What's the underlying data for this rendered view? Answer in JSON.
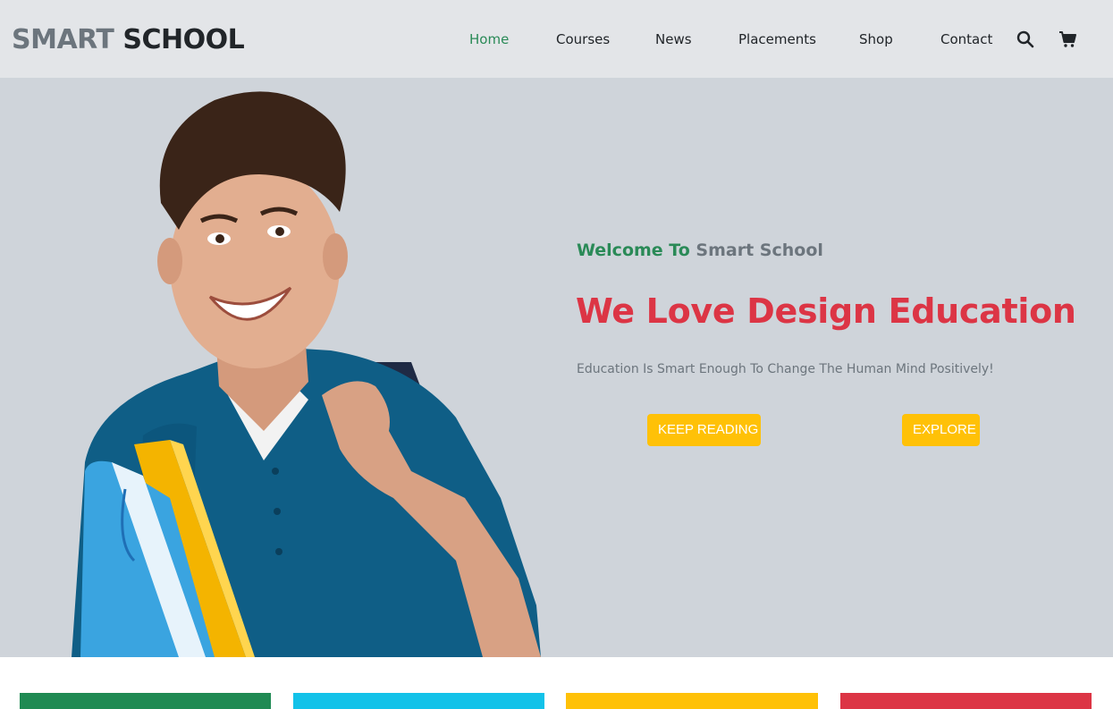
{
  "brand": {
    "part1": "SMART",
    "part2": "SCHOOL"
  },
  "nav": {
    "links": [
      {
        "label": "Home",
        "active": true
      },
      {
        "label": "Courses",
        "active": false
      },
      {
        "label": "News",
        "active": false
      },
      {
        "label": "Placements",
        "active": false
      },
      {
        "label": "Shop",
        "active": false
      },
      {
        "label": "Contact",
        "active": false
      }
    ],
    "icons": [
      "search-icon",
      "cart-icon"
    ]
  },
  "hero": {
    "welcome_prefix": "Welcome To",
    "welcome_suffix": "Smart School",
    "headline": "We Love Design Education",
    "subtext": "Education Is Smart Enough To Change The Human Mind Positively!",
    "primary_button": "KEEP READING",
    "secondary_button": "EXPLORE",
    "image": "student-holding-books"
  },
  "colors": {
    "navbar_bg": "#e3e5e8",
    "hero_bg": "#cfd4da",
    "accent_green": "#2a8a57",
    "headline_red": "#dc3545",
    "button_yellow": "#ffc107",
    "muted_gray": "#6c757d"
  },
  "feature_stripes": [
    "#1f8a53",
    "#12c2e9",
    "#ffc107",
    "#dc3545"
  ]
}
